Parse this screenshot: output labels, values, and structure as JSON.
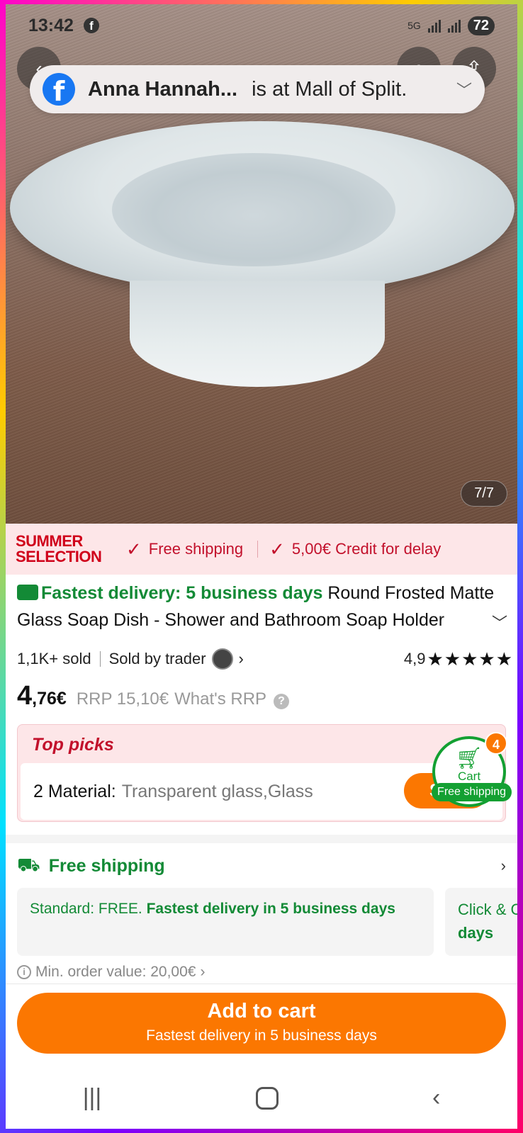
{
  "status_bar": {
    "time": "13:42",
    "network": "5G",
    "battery": "72"
  },
  "notification": {
    "name": "Anna Hannah...",
    "text": "is at Mall of Split."
  },
  "gallery": {
    "counter": "7/7"
  },
  "banner": {
    "line1": "SUMMER",
    "line2": "SELECTION",
    "free_shipping": "Free shipping",
    "credit": "5,00€ Credit for delay"
  },
  "product": {
    "fastest_delivery": "Fastest delivery: 5 business days",
    "title": "Round Frosted Matte Glass Soap Dish - Shower and Bathroom Soap Holder",
    "sold": "1,1K+ sold",
    "sold_by": "Sold by trader",
    "rating": "4,9",
    "stars": "★★★★★",
    "price_int": "4",
    "price_dec": ",76€",
    "rrp": "RRP 15,10€",
    "whats_rrp": "What's RRP"
  },
  "top_picks": {
    "title": "Top picks",
    "material_label": "2 Material:",
    "material_value": "Transparent glass,Glass",
    "select_label": "Se"
  },
  "cart_float": {
    "label": "Cart",
    "count": "4",
    "pill": "Free shipping"
  },
  "shipping": {
    "header": "Free shipping",
    "standard_prefix": "Standard: FREE.",
    "standard_bold": "Fastest delivery in 5 business days",
    "click_collect": "Click & C",
    "click_collect_days": "days",
    "min_order": "Min. order value: 20,00€"
  },
  "add_to_cart": {
    "label": "Add to cart",
    "sub": "Fastest delivery in 5 business days"
  },
  "colors": {
    "accent_orange": "#fb7701",
    "success_green": "#138a36",
    "promo_red": "#c2102b",
    "facebook_blue": "#1877f2"
  }
}
